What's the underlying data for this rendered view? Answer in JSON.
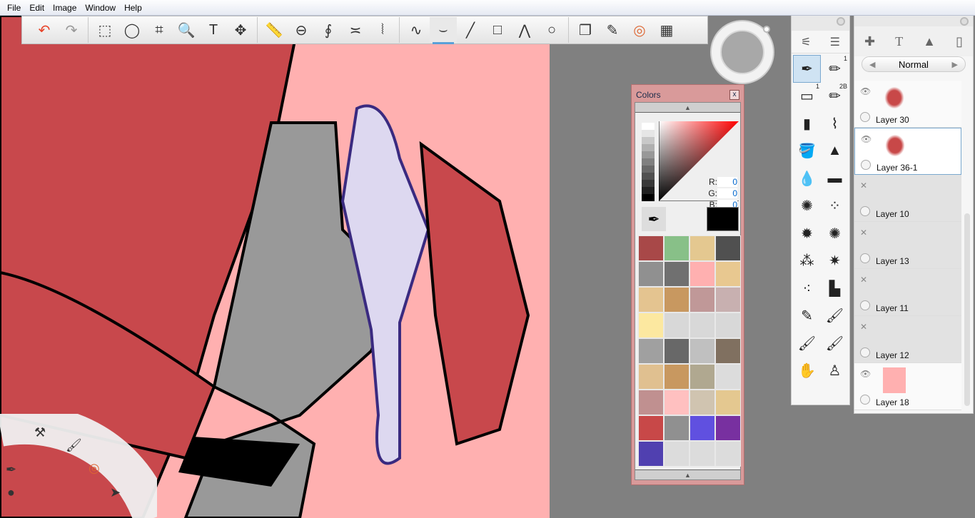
{
  "menu": [
    "File",
    "Edit",
    "Image",
    "Window",
    "Help"
  ],
  "toolbar": {
    "tools": [
      {
        "name": "undo",
        "glyph": "↶",
        "color": "#e8442a"
      },
      {
        "name": "redo",
        "glyph": "↷",
        "color": "#999"
      },
      {
        "name": "select-rect",
        "glyph": "⬚"
      },
      {
        "name": "lasso",
        "glyph": "◯"
      },
      {
        "name": "crop",
        "glyph": "⌗"
      },
      {
        "name": "zoom",
        "glyph": "🔍"
      },
      {
        "name": "text",
        "glyph": "T"
      },
      {
        "name": "transform",
        "glyph": "✥"
      },
      {
        "name": "ruler",
        "glyph": "📏"
      },
      {
        "name": "ellipse-guide",
        "glyph": "⊖"
      },
      {
        "name": "french-curve",
        "glyph": "∮"
      },
      {
        "name": "symmetry-x",
        "glyph": "≍"
      },
      {
        "name": "symmetry-y",
        "glyph": "⦚"
      },
      {
        "name": "freehand",
        "glyph": "∿"
      },
      {
        "name": "steady-stroke",
        "glyph": "⌣",
        "active": true
      },
      {
        "name": "line",
        "glyph": "╱"
      },
      {
        "name": "rectangle",
        "glyph": "□"
      },
      {
        "name": "polyline",
        "glyph": "⋀"
      },
      {
        "name": "circle",
        "glyph": "○"
      },
      {
        "name": "copy-paste",
        "glyph": "❐"
      },
      {
        "name": "brush-palette",
        "glyph": "✎"
      },
      {
        "name": "color-wheel",
        "glyph": "◎",
        "color": "#d63"
      },
      {
        "name": "layout",
        "glyph": "▦"
      }
    ]
  },
  "colors": {
    "title": "Colors",
    "close": "x",
    "r_label": "R:",
    "g_label": "G:",
    "b_label": "B:",
    "r": "0",
    "g": "0",
    "b": "0",
    "current": "#000000",
    "grays": [
      "#ffffff",
      "#e6e6e6",
      "#c8c8c8",
      "#b0b0b0",
      "#989898",
      "#808080",
      "#686868",
      "#505050",
      "#383838",
      "#202020",
      "#000000"
    ],
    "swatches": [
      "#a84848",
      "#88c088",
      "#e4c890",
      "#505050",
      "#909090",
      "#707070",
      "#ffb0b0",
      "#e8c890",
      "#e4c490",
      "#c89860",
      "#c09898",
      "#c8b0b0",
      "#fce8a0",
      "#d8d8d8",
      "#d8d8d8",
      "#d8d8d8",
      "#a0a0a0",
      "#686868",
      "#c0c0c0",
      "#807060",
      "#e0c090",
      "#c89860",
      "#b0a890",
      "#dcdcdc",
      "#c09090",
      "#ffc0c0",
      "#d0c4b0",
      "#e4c890",
      "#c84848",
      "#909090",
      "#6050e0",
      "#7830a0",
      "#5040b0",
      "#dcdcdc",
      "#dcdcdc",
      "#dcdcdc"
    ]
  },
  "brushes": {
    "items": [
      {
        "glyph": "✒",
        "sel": true
      },
      {
        "glyph": "✏",
        "badge": "1"
      },
      {
        "glyph": "▭",
        "badge": "1"
      },
      {
        "glyph": "✏",
        "badge": "2B"
      },
      {
        "glyph": "▮"
      },
      {
        "glyph": "⌇"
      },
      {
        "glyph": "🪣"
      },
      {
        "glyph": "▲"
      },
      {
        "glyph": "💧"
      },
      {
        "glyph": "▬"
      },
      {
        "glyph": "✺"
      },
      {
        "glyph": "⁘"
      },
      {
        "glyph": "✹"
      },
      {
        "glyph": "✺"
      },
      {
        "glyph": "⁂"
      },
      {
        "glyph": "✷"
      },
      {
        "glyph": "⁖"
      },
      {
        "glyph": "▙"
      },
      {
        "glyph": "✎"
      },
      {
        "glyph": "🖌"
      },
      {
        "glyph": "🖌"
      },
      {
        "glyph": "🖌"
      },
      {
        "glyph": "✋"
      },
      {
        "glyph": "♙"
      }
    ]
  },
  "layers": {
    "blend_mode": "Normal",
    "items": [
      {
        "name": "Layer 30",
        "visible": true
      },
      {
        "name": "Layer 36-1",
        "visible": true,
        "selected": true
      },
      {
        "name": "Layer 10",
        "visible": false
      },
      {
        "name": "Layer 13",
        "visible": false
      },
      {
        "name": "Layer 11",
        "visible": false
      },
      {
        "name": "Layer 12",
        "visible": false
      },
      {
        "name": "Layer 18",
        "visible": true
      }
    ]
  }
}
